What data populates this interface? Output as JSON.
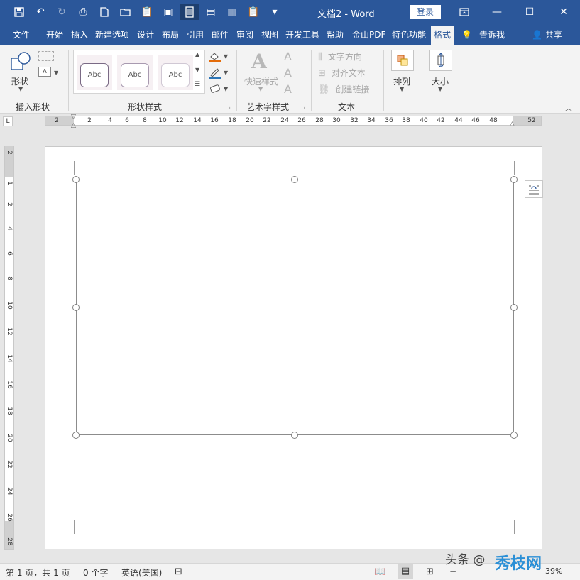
{
  "titlebar": {
    "doc_title": "文档2  -  Word",
    "login_label": "登录"
  },
  "tabs": {
    "items": [
      "文件",
      "开始",
      "插入",
      "新建选项",
      "设计",
      "布局",
      "引用",
      "邮件",
      "审阅",
      "视图",
      "开发工具",
      "帮助",
      "金山PDF",
      "特色功能",
      "格式"
    ],
    "active": "格式",
    "tell_me": "告诉我",
    "share": "共享"
  },
  "ribbon": {
    "insert_shape": {
      "shape_label": "形状",
      "group_label": "插入形状"
    },
    "shape_styles": {
      "thumb_text": "Abc",
      "group_label": "形状样式"
    },
    "wordart": {
      "quick_styles_label": "快速样式",
      "group_label": "艺术字样式"
    },
    "text": {
      "direction": "文字方向",
      "align": "对齐文本",
      "link": "创建链接",
      "group_label": "文本"
    },
    "arrange": {
      "label": "排列"
    },
    "size": {
      "label": "大小"
    }
  },
  "ruler": {
    "horizontal": [
      "2",
      "2",
      "4",
      "6",
      "8",
      "10",
      "12",
      "14",
      "16",
      "18",
      "20",
      "22",
      "24",
      "26",
      "28",
      "30",
      "32",
      "34",
      "36",
      "38",
      "40",
      "42",
      "44",
      "46",
      "48",
      "52"
    ],
    "vertical": [
      "2",
      "1",
      "2",
      "4",
      "6",
      "8",
      "10",
      "12",
      "14",
      "16",
      "18",
      "20",
      "22",
      "24",
      "26",
      "28"
    ]
  },
  "status": {
    "page": "第 1 页，共 1 页",
    "words": "0 个字",
    "language": "英语(美国)",
    "zoom": "39%"
  },
  "watermark": {
    "text": "头条 @",
    "logo": "秀枝网"
  },
  "colors": {
    "brand": "#2b579a",
    "ribbon_bg": "#f3f3f3",
    "canvas_bg": "#e6e6e6"
  }
}
